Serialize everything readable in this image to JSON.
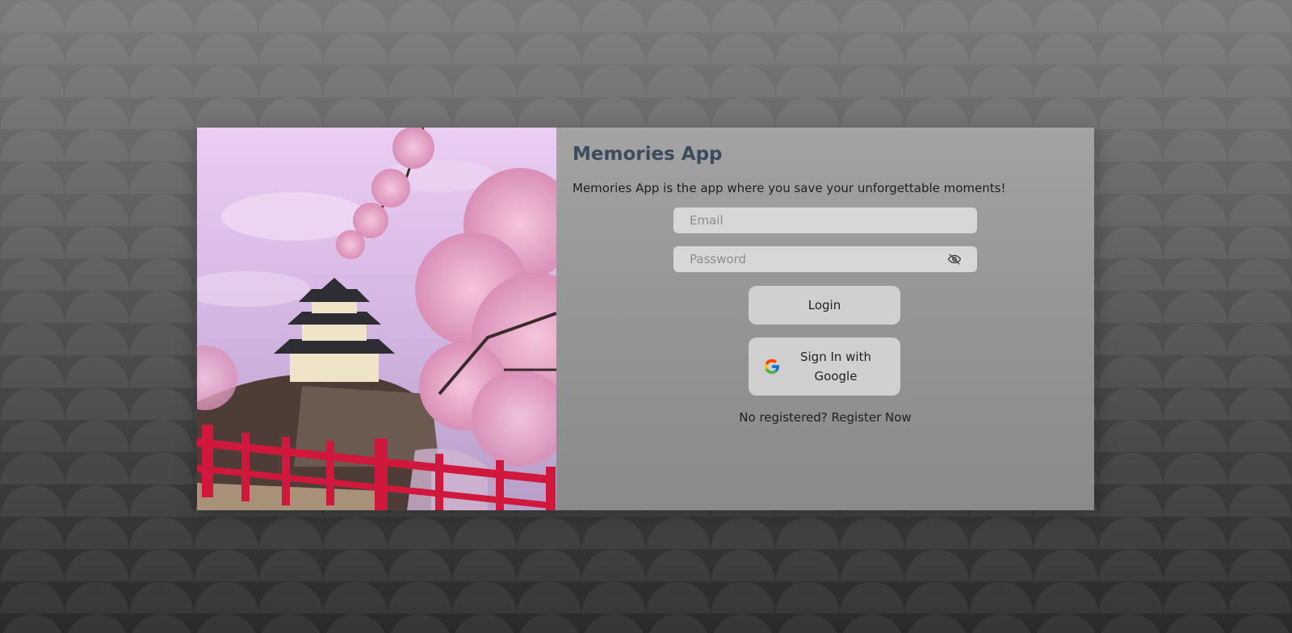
{
  "app": {
    "title": "Memories App",
    "tagline": "Memories App is the app where you save your unforgettable moments!"
  },
  "form": {
    "email_placeholder": "Email",
    "email_value": "",
    "password_placeholder": "Password",
    "password_value": "",
    "password_toggle_icon": "eye-slash-icon",
    "login_label": "Login",
    "google_label": "Sign In with Google",
    "google_icon": "google-g-icon"
  },
  "footer": {
    "prompt": "No registered?",
    "register_link": "Register Now"
  },
  "colors": {
    "title": "#3e4a5e",
    "input_bg": "#d7d7d7",
    "button_bg": "#d0d0d0",
    "rail_red": "#d0183c",
    "blossom_pink": "#e8a6c8"
  }
}
